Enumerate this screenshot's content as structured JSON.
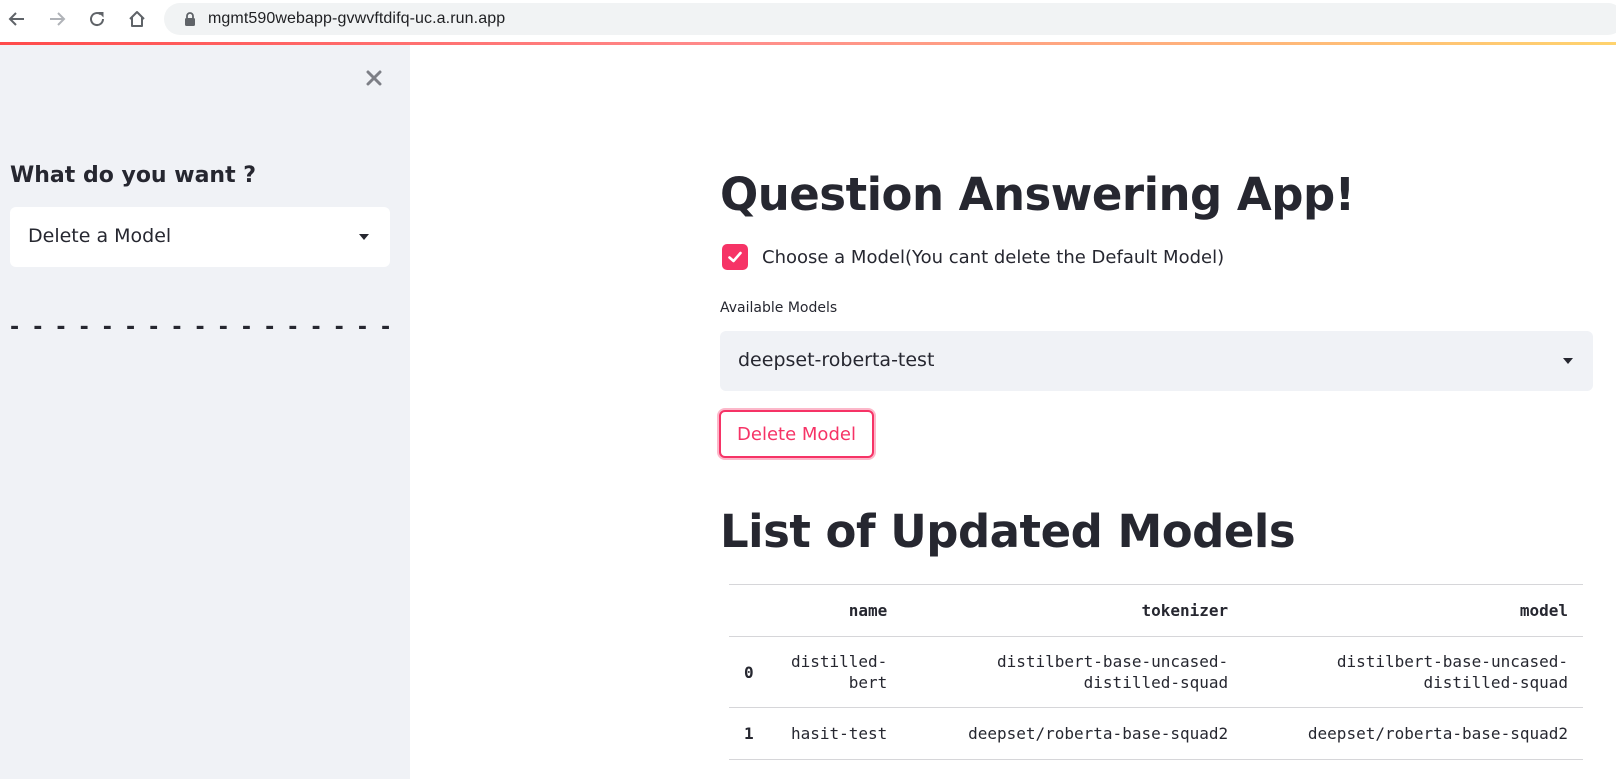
{
  "browser": {
    "url": "mgmt590webapp-gvwvftdifq-uc.a.run.app",
    "back_icon": "arrow-left",
    "forward_icon": "arrow-right",
    "reload_icon": "reload",
    "home_icon": "home",
    "lock_icon": "lock"
  },
  "colors": {
    "accent": "#f63366",
    "sidebar_bg": "#f0f2f6",
    "text": "#262730"
  },
  "sidebar": {
    "close_icon": "close",
    "heading": "What do you want ?",
    "select_value": "Delete a Model",
    "divider": "- - - - - - - - - - - - - - - - -"
  },
  "main": {
    "title": "Question Answering App!",
    "checkbox": {
      "checked": true,
      "label": "Choose a Model(You cant delete the Default Model)"
    },
    "models_label": "Available Models",
    "models_select_value": "deepset-roberta-test",
    "delete_button": "Delete Model",
    "list_title": "List of Updated Models",
    "table": {
      "headers": [
        "",
        "name",
        "tokenizer",
        "model"
      ],
      "rows": [
        {
          "index": "0",
          "name": [
            "distilled-",
            "bert"
          ],
          "tokenizer": [
            "distilbert-base-uncased-",
            "distilled-squad"
          ],
          "model": [
            "distilbert-base-uncased-",
            "distilled-squad"
          ]
        },
        {
          "index": "1",
          "name": [
            "hasit-test"
          ],
          "tokenizer": [
            "deepset/roberta-base-squad2"
          ],
          "model": [
            "deepset/roberta-base-squad2"
          ]
        }
      ]
    }
  }
}
